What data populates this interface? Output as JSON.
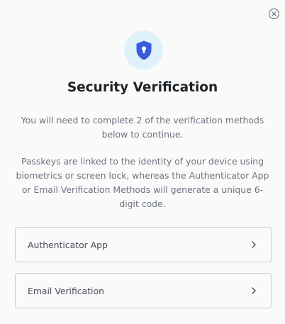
{
  "dialog": {
    "title": "Security Verification",
    "instruction": "You will need to complete 2 of the verification methods below to continue.",
    "description": "Passkeys are linked to the identity of your device using biometrics or screen lock, whereas the Authenticator App or Email Verification Methods will generate a unique 6-digit code.",
    "icons": {
      "close": "close-icon",
      "badge": "shield-keyhole-icon",
      "chevron": "chevron-right-icon"
    },
    "colors": {
      "accent": "#3b5bdb",
      "badge_bg": "#dff2fb"
    },
    "methods": [
      {
        "label": "Authenticator App"
      },
      {
        "label": "Email Verification"
      }
    ]
  }
}
